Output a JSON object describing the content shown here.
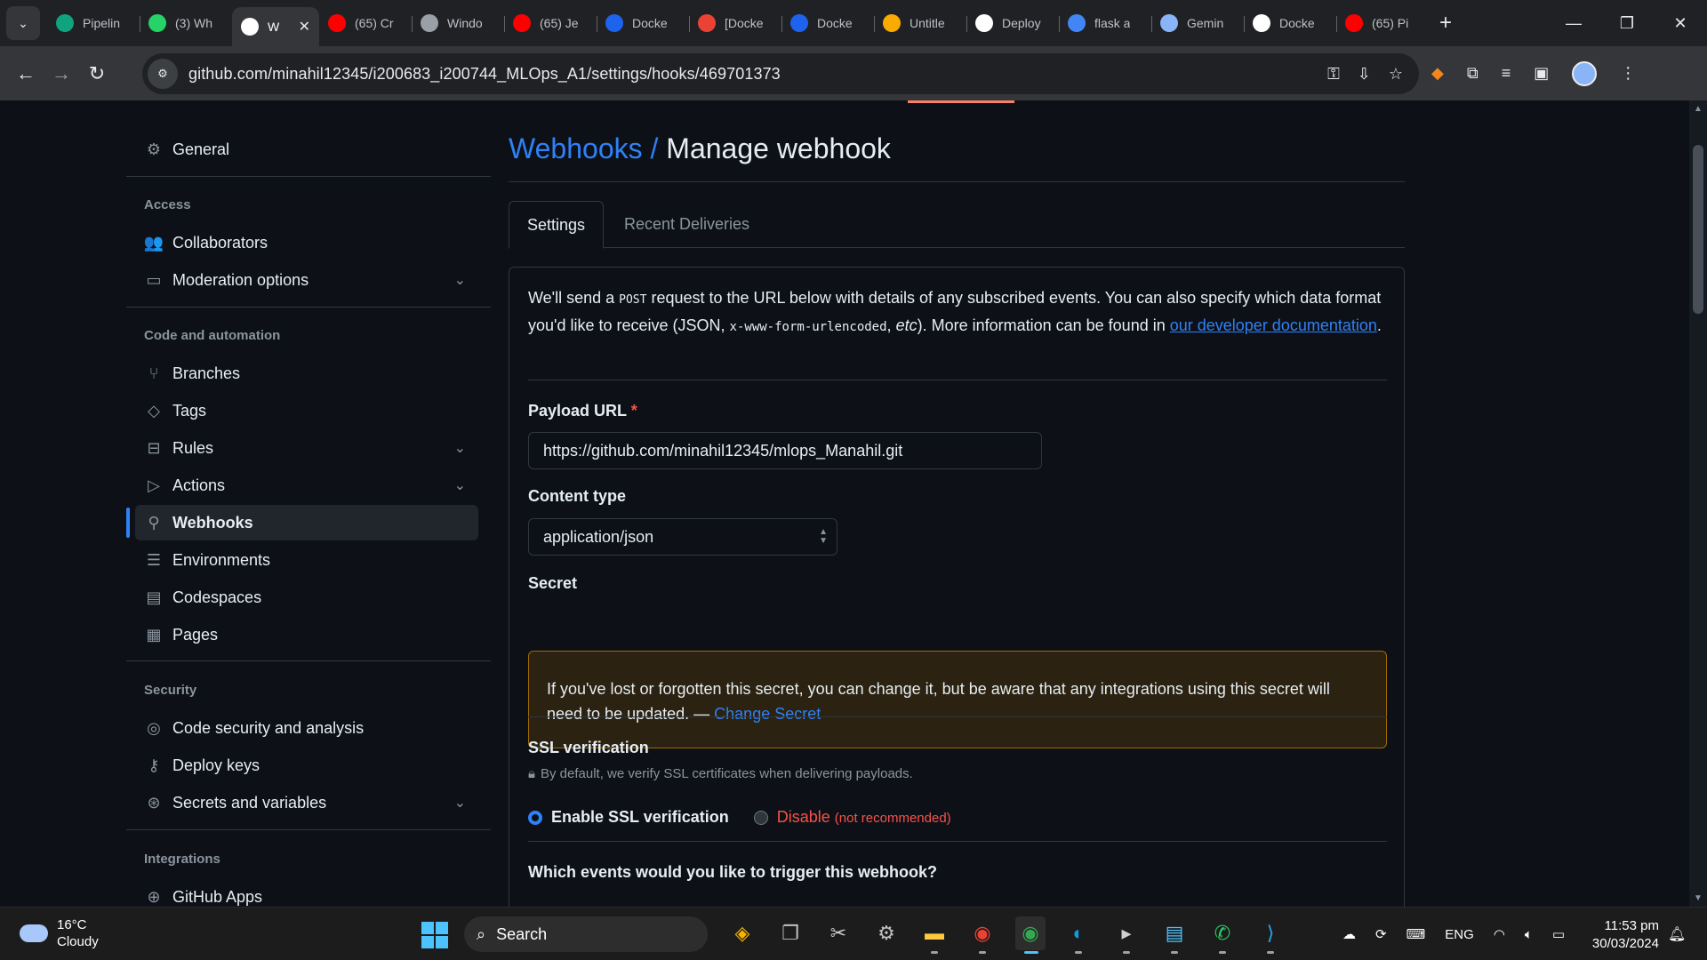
{
  "browser": {
    "tabs": [
      {
        "title": "Pipelin",
        "icon": "openai-icon",
        "color": "#10a37f"
      },
      {
        "title": "(3) Wh",
        "icon": "whatsapp-icon",
        "color": "#25d366"
      },
      {
        "title": "W",
        "icon": "github-icon",
        "color": "#ffffff",
        "active": true
      },
      {
        "title": "(65) Cr",
        "icon": "youtube-icon",
        "color": "#ff0000"
      },
      {
        "title": "Windo",
        "icon": "person-icon",
        "color": "#9aa0a6"
      },
      {
        "title": "(65) Je",
        "icon": "youtube-icon",
        "color": "#ff0000"
      },
      {
        "title": "Docke",
        "icon": "docker-icon",
        "color": "#1d63ed"
      },
      {
        "title": "[Docke",
        "icon": "gmail-icon",
        "color": "#ea4335"
      },
      {
        "title": "Docke",
        "icon": "docker-icon",
        "color": "#1d63ed"
      },
      {
        "title": "Untitle",
        "icon": "colab-icon",
        "color": "#f9ab00"
      },
      {
        "title": "Deploy",
        "icon": "medium-icon",
        "color": "#ffffff"
      },
      {
        "title": "flask a",
        "icon": "google-icon",
        "color": "#4285f4"
      },
      {
        "title": "Gemin",
        "icon": "gemini-icon",
        "color": "#8ab4f8"
      },
      {
        "title": "Docke",
        "icon": "medium-icon",
        "color": "#ffffff"
      },
      {
        "title": "(65) Pi",
        "icon": "youtube-icon",
        "color": "#ff0000"
      }
    ],
    "url": "github.com/minahil12345/i200683_i200744_MLOps_A1/settings/hooks/469701373"
  },
  "sidebar": {
    "general": "General",
    "access_heading": "Access",
    "collaborators": "Collaborators",
    "moderation": "Moderation options",
    "code_heading": "Code and automation",
    "branches": "Branches",
    "tags": "Tags",
    "rules": "Rules",
    "actions": "Actions",
    "webhooks": "Webhooks",
    "environments": "Environments",
    "codespaces": "Codespaces",
    "pages": "Pages",
    "security_heading": "Security",
    "code_security": "Code security and analysis",
    "deploy_keys": "Deploy keys",
    "secrets": "Secrets and variables",
    "integrations_heading": "Integrations",
    "github_apps": "GitHub Apps"
  },
  "main": {
    "crumb": "Webhooks /",
    "title": "Manage webhook",
    "tabs": [
      "Settings",
      "Recent Deliveries"
    ],
    "intro": {
      "p1": "We'll send a ",
      "post": "POST",
      "p2": " request to the URL below with details of any subscribed events. You can also specify which data format you'd like to receive (JSON, ",
      "code": "x-www-form-urlencoded",
      "p3": ", ",
      "etc": "etc",
      "p4": "). More information can be found in ",
      "link": "our developer documentation",
      "p5": "."
    },
    "payload_label": "Payload URL",
    "payload_required": "*",
    "payload_value": "https://github.com/minahil12345/mlops_Manahil.git",
    "content_type_label": "Content type",
    "content_type_value": "application/json",
    "secret_label": "Secret",
    "secret_text": "If you've lost or forgotten this secret, you can change it, but be aware that any integrations using this secret will need to be updated. — ",
    "secret_link": "Change Secret",
    "ssl_label": "SSL verification",
    "ssl_note": "By default, we verify SSL certificates when delivering payloads.",
    "ssl_enable": "Enable SSL verification",
    "ssl_disable": "Disable",
    "ssl_disable_note": "(not recommended)",
    "events_label": "Which events would you like to trigger this webhook?"
  },
  "taskbar": {
    "temp": "16°C",
    "weather": "Cloudy",
    "search": "Search",
    "lang": "ENG",
    "time": "11:53 pm",
    "date": "30/03/2024"
  }
}
